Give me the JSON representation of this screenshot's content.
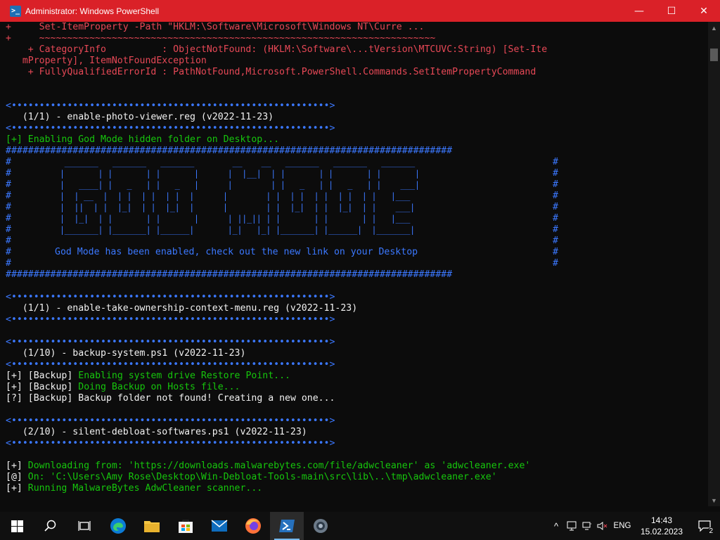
{
  "window": {
    "title": "Administrator: Windows PowerShell",
    "icon": "powershell-icon",
    "minimize": "—",
    "maximize": "☐",
    "close": "✕"
  },
  "console": {
    "error_lines": [
      "+     Set-ItemProperty -Path \"HKLM:\\Software\\Microsoft\\Windows NT\\Curre ...",
      "+     ~~~~~~~~~~~~~~~~~~~~~~~~~~~~~~~~~~~~~~~~~~~~~~~~~~~~~~~~~~~~~~~~~~~~~~~",
      "    + CategoryInfo          : ObjectNotFound: (HKLM:\\Software\\...tVersion\\MTCUVC:String) [Set-Ite",
      "   mProperty], ItemNotFoundException",
      "    + FullyQualifiedErrorId : PathNotFound,Microsoft.PowerShell.Commands.SetItemPropertyCommand"
    ],
    "separator": "<•••••••••••••••••••••••••••••••••••••••••••••••••••••••••>",
    "section1_title": "   (1/1) - enable-photo-viewer.reg (v2022-11-23)",
    "godmode_line": "[+] Enabling God Mode hidden folder on Desktop...",
    "hash_border": "################################################################################",
    "hash_side": "#",
    "godmode_message": "God Mode has been enabled, check out the new link on your Desktop",
    "godmode_art": [
      "  _______   _______   _______        __    __   _______   _______   _______ ",
      " |       | |       | |       |      |  |__|  | |       | |       | |       |",
      " |   ____| |   _   | |   _   |      |        | |   _   | |   _   | |    ___|",
      " |  | __  |  | |  | |  | |  |      |        | |  | |  | |  | |  | |   |___ ",
      " |  ||  | |  |_|  | |  |_|  |      |        | |  |_|  | |  |_|  | |    ___|",
      " |  |_|  | |       | |       |      | ||_|| | |       | |       | |   |___ ",
      " |_______| |_______| |______|       |_|   |_| |_______| |______|  |_______|"
    ],
    "section2_title": "   (1/1) - enable-take-ownership-context-menu.reg (v2022-11-23)",
    "section3_title": "   (1/10) - backup-system.ps1 (v2022-11-23)",
    "backup_lines": [
      {
        "prefix": "[+]",
        "tag": "[Backup]",
        "text": " Enabling system drive Restore Point..."
      },
      {
        "prefix": "[+]",
        "tag": "[Backup]",
        "text": " Doing Backup on Hosts file..."
      },
      {
        "prefix": "[?]",
        "tag": "[Backup]",
        "text": " Backup folder not found! Creating a new one..."
      }
    ],
    "section4_title": "   (2/10) - silent-debloat-softwares.ps1 (v2022-11-23)",
    "download_lines": [
      {
        "prefix": "[+]",
        "text": " Downloading from: 'https://downloads.malwarebytes.com/file/adwcleaner' as 'adwcleaner.exe'"
      },
      {
        "prefix": "[@]",
        "text": " On: 'C:\\Users\\Amy Rose\\Desktop\\Win-Debloat-Tools-main\\src\\lib\\..\\tmp\\adwcleaner.exe'"
      },
      {
        "prefix": "[+]",
        "text": " Running MalwareBytes AdwCleaner scanner..."
      }
    ]
  },
  "taskbar": {
    "apps": [
      {
        "name": "start",
        "icon": "windows-logo-icon"
      },
      {
        "name": "search",
        "icon": "search-icon"
      },
      {
        "name": "task-view",
        "icon": "task-view-icon"
      },
      {
        "name": "edge",
        "icon": "edge-icon"
      },
      {
        "name": "file-explorer",
        "icon": "folder-icon"
      },
      {
        "name": "store",
        "icon": "store-icon"
      },
      {
        "name": "mail",
        "icon": "mail-icon"
      },
      {
        "name": "firefox",
        "icon": "firefox-icon"
      },
      {
        "name": "powershell",
        "icon": "powershell-icon",
        "active": true
      },
      {
        "name": "settings",
        "icon": "gear-icon"
      }
    ],
    "language": "ENG",
    "time": "14:43",
    "date": "15.02.2023",
    "notification_count": "2"
  },
  "colors": {
    "titlebar": "#da2128",
    "console_bg": "#0c0c0c",
    "error_red": "#e74856",
    "success_green": "#16c60c",
    "info_blue": "#3b78ff"
  }
}
